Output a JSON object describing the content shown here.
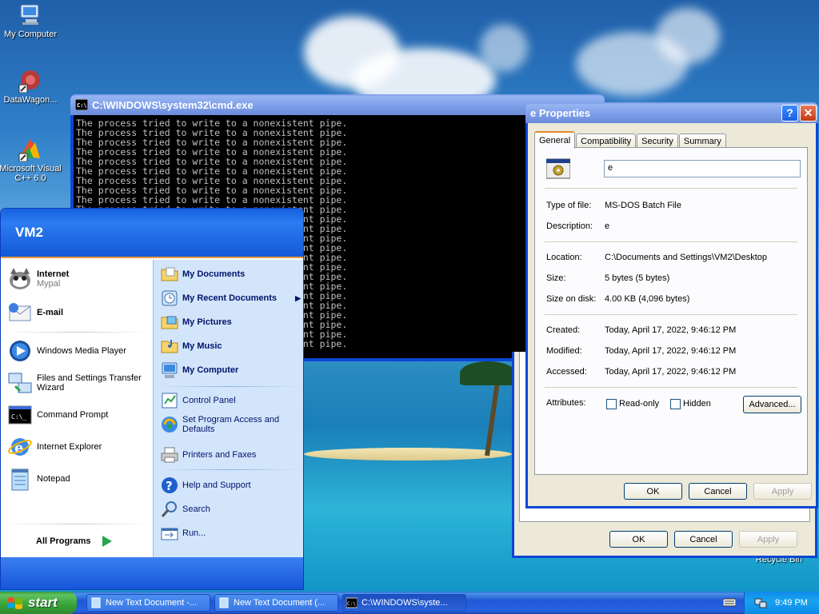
{
  "desktop": {
    "icons": [
      {
        "label": "My Computer",
        "icon": "my-computer-icon"
      },
      {
        "label": "DataWagon...",
        "icon": "datawagon-icon"
      },
      {
        "label": "Microsoft Visual C++ 6.0",
        "icon": "visual-cpp-icon"
      },
      {
        "label": "Recycle Bin",
        "icon": "recycle-bin-icon"
      }
    ]
  },
  "cmd": {
    "title": "C:\\WINDOWS\\system32\\cmd.exe",
    "lines": [
      "The process tried to write to a nonexistent pipe.",
      "The process tried to write to a nonexistent pipe.",
      "The process tried to write to a nonexistent pipe.",
      "The process tried to write to a nonexistent pipe.",
      "The process tried to write to a nonexistent pipe.",
      "The process tried to write to a nonexistent pipe.",
      "The process tried to write to a nonexistent pipe.",
      "The process tried to write to a nonexistent pipe.",
      "The process tried to write to a nonexistent pipe.",
      "The process tried to write to a nonexistent pipe.",
      "The process tried to write to a nonexistent pipe.",
      "The process tried to write to a nonexistent pipe.",
      "The process tried to write to a nonexistent pipe.",
      "The process tried to write to a nonexistent pipe.",
      "The process tried to write to a nonexistent pipe.",
      "The process tried to write to a nonexistent pipe.",
      "The process tried to write to a nonexistent pipe.",
      "The process tried to write to a nonexistent pipe.",
      "The process tried to write to a nonexistent pipe.",
      "The process tried to write to a nonexistent pipe.",
      "The process tried to write to a nonexistent pipe.",
      "The process tried to write to a nonexistent pipe.",
      "The process tried to write to a nonexistent pipe.",
      "The process tried to write to a nonexistent pipe."
    ]
  },
  "props": {
    "title": "e Properties",
    "help_btn": "?",
    "close_btn": "✕",
    "tabs": [
      "General",
      "Compatibility",
      "Security",
      "Summary"
    ],
    "filename": "e",
    "type_label": "Type of file:",
    "type_value": "MS-DOS Batch File",
    "desc_label": "Description:",
    "desc_value": "e",
    "location_label": "Location:",
    "location_value": "C:\\Documents and Settings\\VM2\\Desktop",
    "size_label": "Size:",
    "size_value": "5 bytes (5 bytes)",
    "sizedisk_label": "Size on disk:",
    "sizedisk_value": "4.00 KB (4,096 bytes)",
    "created_label": "Created:",
    "created_value": "Today, April 17, 2022, 9:46:12 PM",
    "modified_label": "Modified:",
    "modified_value": "Today, April 17, 2022, 9:46:12 PM",
    "accessed_label": "Accessed:",
    "accessed_value": "Today, April 17, 2022, 9:46:12 PM",
    "attributes_label": "Attributes:",
    "readonly_label": "Read-only",
    "hidden_label": "Hidden",
    "advanced_btn": "Advanced...",
    "ok": "OK",
    "cancel": "Cancel",
    "apply": "Apply"
  },
  "props_back": {
    "ok": "OK",
    "cancel": "Cancel",
    "apply": "Apply"
  },
  "startmenu": {
    "user": "VM2",
    "pinned": [
      {
        "title": "Internet",
        "sub": "Mypal",
        "icon": "mypal-icon"
      },
      {
        "title": "E-mail",
        "sub": "",
        "icon": "email-icon"
      }
    ],
    "recent": [
      {
        "label": "Windows Media Player",
        "icon": "media-player-icon"
      },
      {
        "label": "Files and Settings Transfer Wizard",
        "icon": "transfer-wizard-icon"
      },
      {
        "label": "Command Prompt",
        "icon": "command-prompt-icon"
      },
      {
        "label": "Internet Explorer",
        "icon": "internet-explorer-icon"
      },
      {
        "label": "Notepad",
        "icon": "notepad-icon"
      }
    ],
    "all_programs": "All Programs",
    "right": [
      {
        "label": "My Documents",
        "bold": true
      },
      {
        "label": "My Recent Documents",
        "bold": true
      },
      {
        "label": "My Pictures",
        "bold": true
      },
      {
        "label": "My Music",
        "bold": true
      },
      {
        "label": "My Computer",
        "bold": true
      },
      {
        "label": "Control Panel",
        "bold": false
      },
      {
        "label": "Set Program Access and Defaults",
        "bold": false
      },
      {
        "label": "Printers and Faxes",
        "bold": false
      },
      {
        "label": "Help and Support",
        "bold": false
      },
      {
        "label": "Search",
        "bold": false
      },
      {
        "label": "Run...",
        "bold": false
      }
    ]
  },
  "taskbar": {
    "start": "start",
    "tasks": [
      {
        "label": "New Text Document -...",
        "icon": "notepad-icon"
      },
      {
        "label": "New Text Document (...",
        "icon": "notepad-icon"
      },
      {
        "label": "C:\\WINDOWS\\syste...",
        "icon": "cmd-icon"
      }
    ],
    "clock": "9:49 PM"
  },
  "colors": {
    "title_blue": "#0554dd",
    "start_green": "#37a137",
    "taskbar_blue": "#2157d7",
    "tab_highlight": "#e68b2c"
  }
}
